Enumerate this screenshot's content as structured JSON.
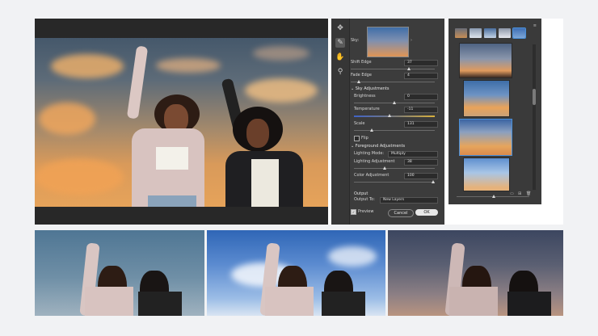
{
  "panel": {
    "sky_label": "Sky:",
    "shift_edge": {
      "label": "Shift Edge",
      "value": "37",
      "level": 0.64
    },
    "fade_edge": {
      "label": "Fade Edge",
      "value": "4",
      "level": 0.08
    },
    "sky_adjustments": "Sky Adjustments",
    "brightness": {
      "label": "Brightness",
      "value": "0",
      "level": 0.5
    },
    "temperature": {
      "label": "Temperature",
      "value": "-11",
      "level": 0.44
    },
    "scale": {
      "label": "Scale",
      "value": "131",
      "level": 0.22
    },
    "flip_label": "Flip",
    "fg_adjustments": "Foreground Adjustments",
    "lighting_mode": {
      "label": "Lighting Mode:",
      "value": "Multiply"
    },
    "lighting_adjustment": {
      "label": "Lighting Adjustment",
      "value": "38",
      "level": 0.38
    },
    "color_adjustment": {
      "label": "Color Adjustment",
      "value": "100",
      "level": 1.0
    },
    "output_label": "Output",
    "output_to": {
      "label": "Output To:",
      "value": "New Layers"
    },
    "preview_label": "Preview",
    "cancel_label": "Cancel",
    "ok_label": "OK"
  },
  "tools": [
    "move-sky-tool",
    "sky-brush-tool",
    "hand-tool",
    "zoom-tool"
  ],
  "colors": {
    "accent": "#4a90d9",
    "panel": "#3c3c3c",
    "ok_button": "#e8e8e8"
  }
}
